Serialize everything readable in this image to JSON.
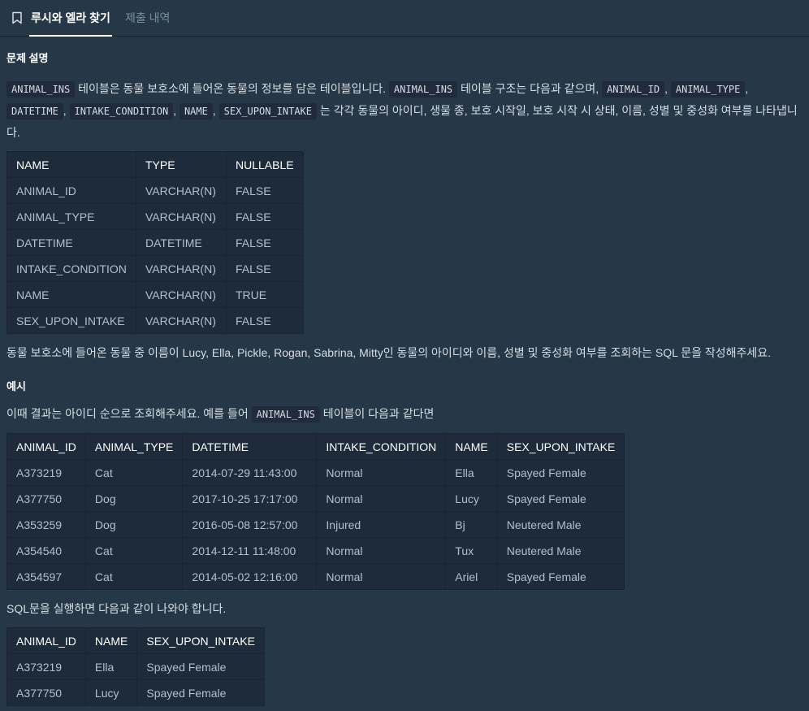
{
  "tabs": {
    "active": "루시와 엘라 찾기",
    "inactive": "제출 내역"
  },
  "description": {
    "heading": "문제 설명",
    "para1": {
      "code_animal_ins": "ANIMAL_INS",
      "t1": " 테이블은 동물 보호소에 들어온 동물의 정보를 담은 테이블입니다. ",
      "t2": " 테이블 구조는 다음과 같으며, ",
      "code_animal_id": "ANIMAL_ID",
      "comma": ", ",
      "code_animal_type": "ANIMAL_TYPE",
      "code_datetime": "DATETIME",
      "code_intake_condition": "INTAKE_CONDITION",
      "code_name": "NAME",
      "code_sex": "SEX_UPON_INTAKE",
      "t3": " 는 각각 동물의 아이디, 생물 종, 보호 시작일, 보호 시작 시 상태, 이름, 성별 및 중성화 여부를 나타냅니다."
    },
    "schema_table": {
      "headers": [
        "NAME",
        "TYPE",
        "NULLABLE"
      ],
      "rows": [
        [
          "ANIMAL_ID",
          "VARCHAR(N)",
          "FALSE"
        ],
        [
          "ANIMAL_TYPE",
          "VARCHAR(N)",
          "FALSE"
        ],
        [
          "DATETIME",
          "DATETIME",
          "FALSE"
        ],
        [
          "INTAKE_CONDITION",
          "VARCHAR(N)",
          "FALSE"
        ],
        [
          "NAME",
          "VARCHAR(N)",
          "TRUE"
        ],
        [
          "SEX_UPON_INTAKE",
          "VARCHAR(N)",
          "FALSE"
        ]
      ]
    },
    "task": "동물 보호소에 들어온 동물 중 이름이 Lucy, Ella, Pickle, Rogan, Sabrina, Mitty인 동물의 아이디와 이름, 성별 및 중성화 여부를 조회하는 SQL 문을 작성해주세요."
  },
  "example": {
    "heading": "예시",
    "intro_before": "이때 결과는 아이디 순으로 조회해주세요. 예를 들어 ",
    "intro_code": "ANIMAL_INS",
    "intro_after": " 테이블이 다음과 같다면",
    "input_table": {
      "headers": [
        "ANIMAL_ID",
        "ANIMAL_TYPE",
        "DATETIME",
        "INTAKE_CONDITION",
        "NAME",
        "SEX_UPON_INTAKE"
      ],
      "rows": [
        [
          "A373219",
          "Cat",
          "2014-07-29 11:43:00",
          "Normal",
          "Ella",
          "Spayed Female"
        ],
        [
          "A377750",
          "Dog",
          "2017-10-25 17:17:00",
          "Normal",
          "Lucy",
          "Spayed Female"
        ],
        [
          "A353259",
          "Dog",
          "2016-05-08 12:57:00",
          "Injured",
          "Bj",
          "Neutered Male"
        ],
        [
          "A354540",
          "Cat",
          "2014-12-11 11:48:00",
          "Normal",
          "Tux",
          "Neutered Male"
        ],
        [
          "A354597",
          "Cat",
          "2014-05-02 12:16:00",
          "Normal",
          "Ariel",
          "Spayed Female"
        ]
      ]
    },
    "result_intro": "SQL문을 실행하면 다음과 같이 나와야 합니다.",
    "result_table": {
      "headers": [
        "ANIMAL_ID",
        "NAME",
        "SEX_UPON_INTAKE"
      ],
      "rows": [
        [
          "A373219",
          "Ella",
          "Spayed Female"
        ],
        [
          "A377750",
          "Lucy",
          "Spayed Female"
        ]
      ]
    }
  },
  "icons": {
    "bookmark": "bookmark-icon"
  }
}
